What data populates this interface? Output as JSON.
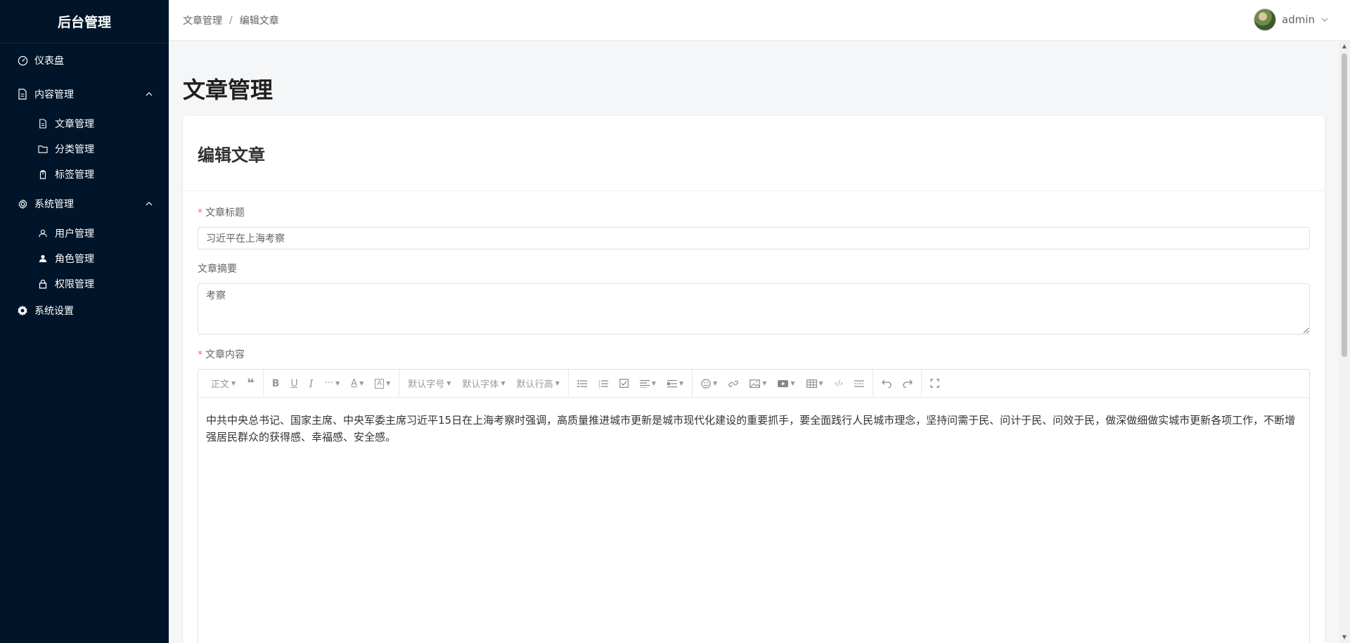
{
  "sidebar": {
    "logo": "后台管理",
    "items": [
      {
        "label": "仪表盘"
      },
      {
        "label": "内容管理",
        "children": [
          {
            "label": "文章管理"
          },
          {
            "label": "分类管理"
          },
          {
            "label": "标签管理"
          }
        ]
      },
      {
        "label": "系统管理",
        "children": [
          {
            "label": "用户管理"
          },
          {
            "label": "角色管理"
          },
          {
            "label": "权限管理"
          }
        ]
      },
      {
        "label": "系统设置"
      }
    ]
  },
  "header": {
    "breadcrumb": [
      "文章管理",
      "编辑文章"
    ],
    "breadcrumb_sep": "/",
    "user": "admin"
  },
  "page": {
    "title": "文章管理",
    "card_title": "编辑文章"
  },
  "form": {
    "title_label": "文章标题",
    "title_value": "习近平在上海考察",
    "summary_label": "文章摘要",
    "summary_value": "考察",
    "content_label": "文章内容",
    "required_mark": "*"
  },
  "editor": {
    "toolbar": {
      "paragraph": "正文",
      "font_size": "默认字号",
      "font_family": "默认字体",
      "line_height": "默认行高"
    },
    "content": "中共中央总书记、国家主席、中央军委主席习近平15日在上海考察时强调，高质量推进城市更新是城市现代化建设的重要抓手，要全面践行人民城市理念，坚持问需于民、问计于民、问效于民，做深做细做实城市更新各项工作，不断增强居民群众的获得感、幸福感、安全感。"
  },
  "colors": {
    "sidebar_bg": "#001529",
    "required": "#f56c6c"
  }
}
